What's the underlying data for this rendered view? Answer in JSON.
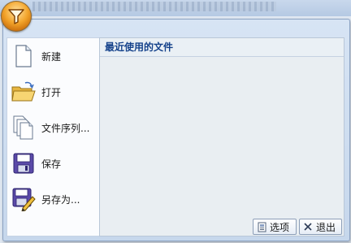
{
  "menu": {
    "items": [
      {
        "label": "新建",
        "icon": "new-document-icon"
      },
      {
        "label": "打开",
        "icon": "open-folder-icon"
      },
      {
        "label": "文件序列...",
        "icon": "file-sequence-icon"
      },
      {
        "label": "保存",
        "icon": "save-floppy-icon"
      },
      {
        "label": "另存为...",
        "icon": "save-as-icon"
      }
    ],
    "recent_title": "最近使用的文件"
  },
  "footer": {
    "options_label": "选项",
    "exit_label": "退出"
  },
  "colors": {
    "accent": "#15428b",
    "office_button": "#f3a52c"
  }
}
